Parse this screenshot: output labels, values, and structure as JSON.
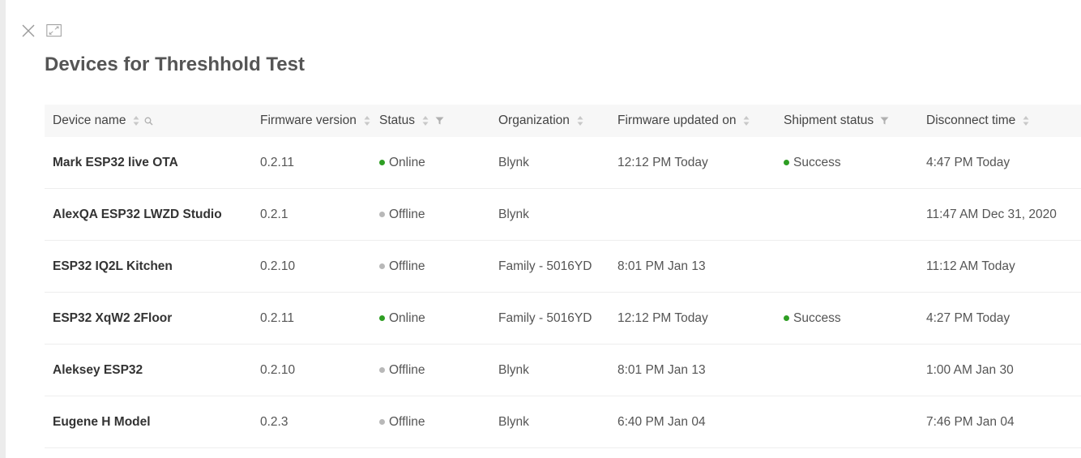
{
  "header": {
    "title": "Devices for Threshhold Test",
    "close_icon": "close-icon",
    "expand_icon": "expand-icon"
  },
  "colors": {
    "online": "#2e9e23",
    "offline": "#b8b8b8",
    "success": "#2e9e23",
    "header_bg": "#f7f7f7",
    "icon": "#9a9a9a"
  },
  "table": {
    "columns": [
      {
        "label": "Device name",
        "sortable": true,
        "searchable": true
      },
      {
        "label": "Firmware version",
        "sortable": true
      },
      {
        "label": "Status",
        "sortable": true,
        "filterable": true
      },
      {
        "label": "Organization",
        "sortable": true
      },
      {
        "label": "Firmware updated on",
        "sortable": true
      },
      {
        "label": "Shipment status",
        "filterable": true
      },
      {
        "label": "Disconnect time",
        "sortable": true
      }
    ],
    "rows": [
      {
        "name": "Mark ESP32 live OTA",
        "firmware": "0.2.11",
        "status": "Online",
        "organization": "Blynk",
        "fw_updated": "12:12 PM Today",
        "shipment": "Success",
        "disconnect": "4:47 PM Today"
      },
      {
        "name": "AlexQA ESP32 LWZD Studio",
        "firmware": "0.2.1",
        "status": "Offline",
        "organization": "Blynk",
        "fw_updated": "",
        "shipment": "",
        "disconnect": "11:47 AM Dec 31, 2020"
      },
      {
        "name": "ESP32 IQ2L Kitchen",
        "firmware": "0.2.10",
        "status": "Offline",
        "organization": "Family - 5016YD",
        "fw_updated": "8:01 PM Jan 13",
        "shipment": "",
        "disconnect": "11:12 AM Today"
      },
      {
        "name": "ESP32 XqW2 2Floor",
        "firmware": "0.2.11",
        "status": "Online",
        "organization": "Family - 5016YD",
        "fw_updated": "12:12 PM Today",
        "shipment": "Success",
        "disconnect": "4:27 PM Today"
      },
      {
        "name": "Aleksey ESP32",
        "firmware": "0.2.10",
        "status": "Offline",
        "organization": "Blynk",
        "fw_updated": "8:01 PM Jan 13",
        "shipment": "",
        "disconnect": "1:00 AM Jan 30"
      },
      {
        "name": "Eugene H Model",
        "firmware": "0.2.3",
        "status": "Offline",
        "organization": "Blynk",
        "fw_updated": "6:40 PM Jan 04",
        "shipment": "",
        "disconnect": "7:46 PM Jan 04"
      }
    ]
  }
}
